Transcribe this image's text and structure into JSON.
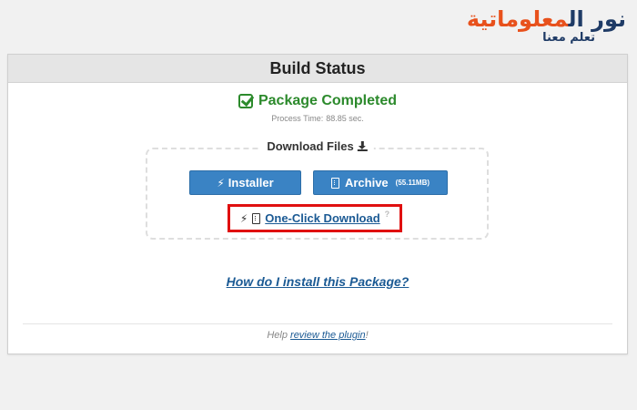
{
  "watermark": {
    "line1_part1": "نور ال",
    "line1_part2": "معلوماتية",
    "line2": "تعلم معنا"
  },
  "panel": {
    "title": "Build Status",
    "status": "Package Completed",
    "process_time_label": "Process Time:",
    "process_time_value": "88.85 sec.",
    "download_title": "Download Files",
    "installer_label": "Installer",
    "archive_label": "Archive",
    "archive_size": "(55.11MB)",
    "oneclick_label": "One-Click Download",
    "install_help_link": "How do I install this Package?",
    "footer_prefix": "Help",
    "footer_link": "review the plugin",
    "footer_suffix": "!"
  },
  "colors": {
    "accent_blue": "#3a83c4",
    "success_green": "#2c8a2c",
    "highlight_red": "#e01010",
    "link_blue": "#1b5a94"
  }
}
